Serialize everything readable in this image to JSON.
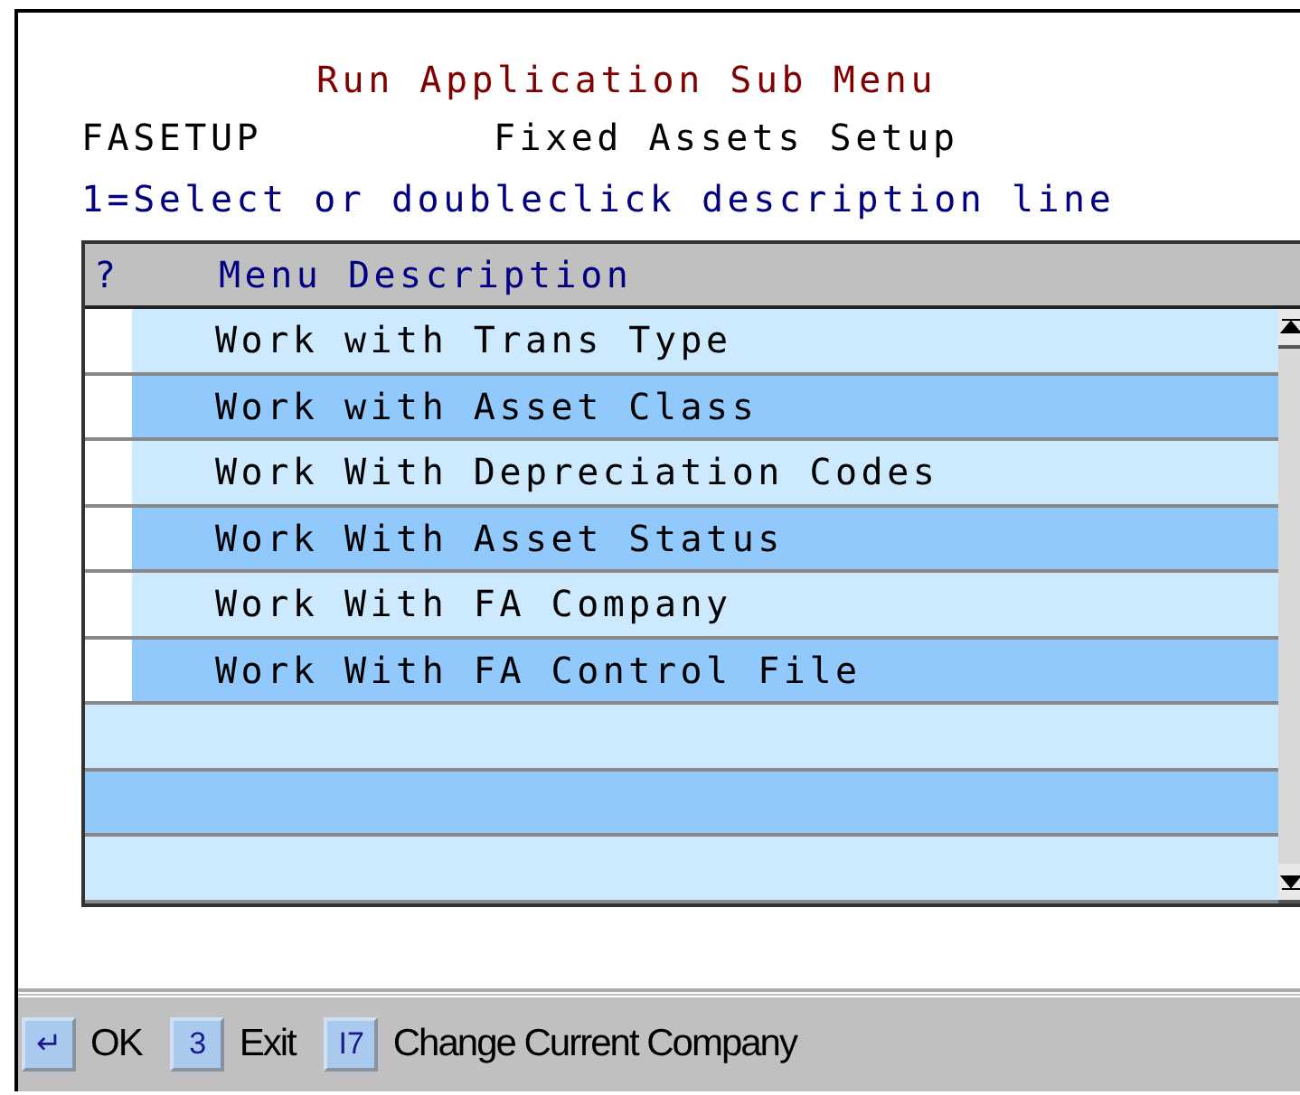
{
  "title": "Run Application Sub Menu",
  "menu": {
    "code": "FASETUP",
    "name": "Fixed Assets Setup"
  },
  "instruction": "1=Select or doubleclick description line",
  "table": {
    "columns": [
      "?",
      "Menu Description"
    ],
    "rows": [
      {
        "option": "",
        "description": "Work with Trans Type"
      },
      {
        "option": "",
        "description": "Work with Asset Class"
      },
      {
        "option": "",
        "description": "Work With Depreciation Codes"
      },
      {
        "option": "",
        "description": "Work With Asset Status"
      },
      {
        "option": "",
        "description": "Work With FA Company"
      },
      {
        "option": "",
        "description": "Work With FA Control File"
      }
    ]
  },
  "function_keys": [
    {
      "key": "↵",
      "label": "OK"
    },
    {
      "key": "3",
      "label": "Exit"
    },
    {
      "key": "I7",
      "label": "Change Current Company"
    }
  ]
}
